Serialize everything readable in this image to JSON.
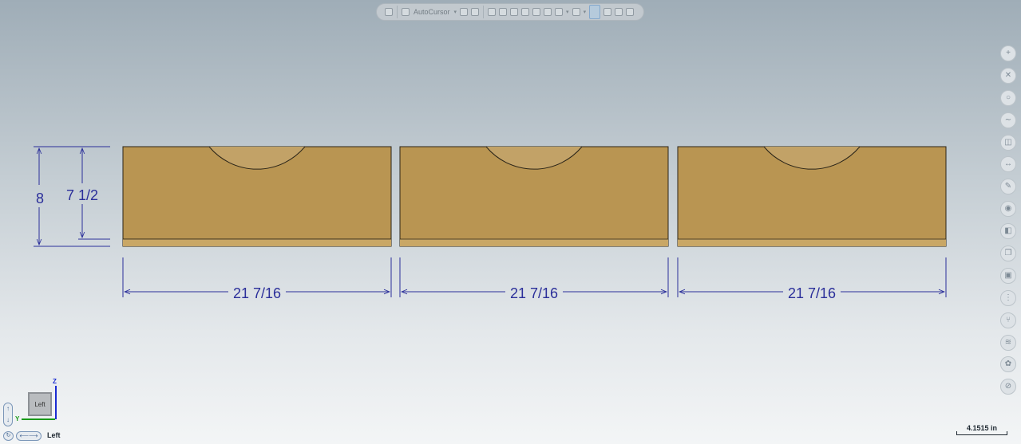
{
  "toolbar": {
    "autocursor_label": "AutoCursor",
    "icons": [
      "new-file-icon",
      "autocursor-icon",
      "xyz-axis-icon",
      "gear-icon",
      "select-icon",
      "orbit-icon",
      "pan-icon",
      "zoom-icon",
      "view-icon",
      "cube-shade-icon",
      "wireframe-icon",
      "grid-icon",
      "snap-icon",
      "measure-icon",
      "refresh-icon",
      "undo-icon"
    ]
  },
  "side_tools": [
    {
      "name": "plus-icon",
      "glyph": "+"
    },
    {
      "name": "line-icon",
      "glyph": "✕"
    },
    {
      "name": "circle-icon",
      "glyph": "○"
    },
    {
      "name": "curve-icon",
      "glyph": "∼"
    },
    {
      "name": "camera-icon",
      "glyph": "◫"
    },
    {
      "name": "dimension-icon",
      "glyph": "↔"
    },
    {
      "name": "paint-icon",
      "glyph": "✎"
    },
    {
      "name": "render-icon",
      "glyph": "◉"
    },
    {
      "name": "material-icon",
      "glyph": "◧"
    },
    {
      "name": "copy-icon",
      "glyph": "❐"
    },
    {
      "name": "red-box-icon",
      "glyph": "▣"
    },
    {
      "name": "align-icon",
      "glyph": "⋮"
    },
    {
      "name": "tree-icon",
      "glyph": "⑂"
    },
    {
      "name": "layers-icon",
      "glyph": "≋"
    },
    {
      "name": "settings-icon",
      "glyph": "✿"
    },
    {
      "name": "prohibit-icon",
      "glyph": "⊘"
    }
  ],
  "dimensions": {
    "overall_height": "8",
    "inner_height": "7 1/2",
    "widths": [
      "21 7/16",
      "21 7/16",
      "21 7/16"
    ]
  },
  "view": {
    "name": "Left",
    "cube_label": "Left",
    "axis_z": "Z",
    "axis_y": "Y"
  },
  "scale": {
    "label": "4.1515 in"
  },
  "colors": {
    "wood_face": "#b99552",
    "wood_edge": "#2a2418",
    "dimension_line": "#2b2f9a"
  }
}
